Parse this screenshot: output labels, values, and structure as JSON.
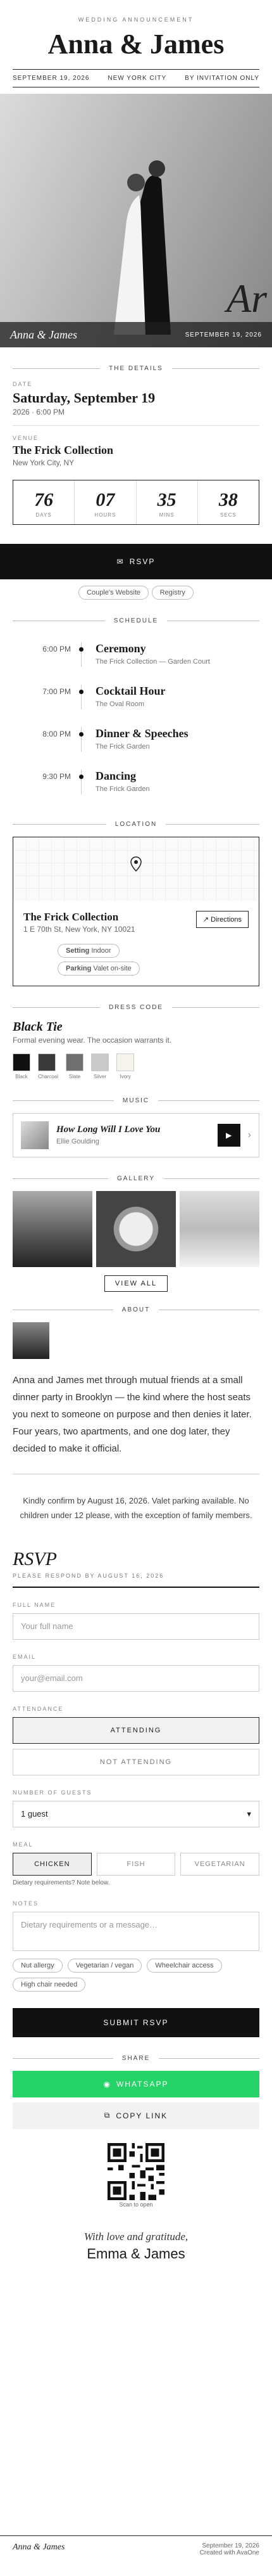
{
  "header": {
    "kicker": "WEDDING ANNOUNCEMENT",
    "names": "Anna & James",
    "date": "SEPTEMBER 19, 2026",
    "city": "NEW YORK CITY",
    "access": "BY INVITATION ONLY"
  },
  "hero": {
    "names": "Anna & James",
    "date": "SEPTEMBER 19, 2026",
    "monogram": "Ar"
  },
  "details": {
    "title": "THE DETAILS",
    "date_label": "DATE",
    "date_value": "Saturday, September 19",
    "time": "2026 · 6:00 PM",
    "venue_label": "VENUE",
    "venue": "The Frick Collection",
    "venue_city": "New York City, NY"
  },
  "countdown": [
    {
      "n": "76",
      "u": "DAYS"
    },
    {
      "n": "07",
      "u": "HOURS"
    },
    {
      "n": "35",
      "u": "MINS"
    },
    {
      "n": "38",
      "u": "SECS"
    }
  ],
  "rsvp_bar": "RSVP",
  "links": [
    "Couple's Website",
    "Registry"
  ],
  "schedule": {
    "title": "SCHEDULE",
    "items": [
      {
        "t": "6:00 PM",
        "e": "Ceremony",
        "p": "The Frick Collection — Garden Court"
      },
      {
        "t": "7:00 PM",
        "e": "Cocktail Hour",
        "p": "The Oval Room"
      },
      {
        "t": "8:00 PM",
        "e": "Dinner & Speeches",
        "p": "The Frick Garden"
      },
      {
        "t": "9:30 PM",
        "e": "Dancing",
        "p": "The Frick Garden"
      }
    ]
  },
  "location": {
    "title": "LOCATION",
    "venue": "The Frick Collection",
    "address": "1 E 70th St, New York, NY 10021",
    "directions": "Directions",
    "tag1_k": "Setting",
    "tag1_v": "Indoor",
    "tag2_k": "Parking",
    "tag2_v": "Valet on-site"
  },
  "dress": {
    "title": "DRESS CODE",
    "name": "Black Tie",
    "desc": "Formal evening wear. The occasion warrants it.",
    "swatches": [
      {
        "n": "Black",
        "c": "#111111"
      },
      {
        "n": "Charcoal",
        "c": "#3a3a3a"
      },
      {
        "n": "Slate",
        "c": "#707070"
      },
      {
        "n": "Silver",
        "c": "#c9c9c9"
      },
      {
        "n": "Ivory",
        "c": "#f6f3ec"
      }
    ]
  },
  "music": {
    "title": "MUSIC",
    "song": "How Long Will I Love You",
    "artist": "Ellie Goulding"
  },
  "gallery": {
    "title": "GALLERY",
    "view_all": "VIEW ALL"
  },
  "about": {
    "title": "ABOUT",
    "text": "Anna and James met through mutual friends at a small dinner party in Brooklyn — the kind where the host seats you next to someone on purpose and then denies it later. Four years, two apartments, and one dog later, they decided to make it official."
  },
  "note": "Kindly confirm by August 16, 2026. Valet parking available. No children under 12 please, with the exception of family members.",
  "rsvp": {
    "title": "RSVP",
    "deadline": "PLEASE RESPOND BY AUGUST 16, 2026",
    "name_label": "FULL NAME",
    "name_ph": "Your full name",
    "email_label": "EMAIL",
    "email_ph": "your@email.com",
    "att_label": "ATTENDANCE",
    "attending": "ATTENDING",
    "not_attending": "NOT ATTENDING",
    "guests_label": "NUMBER OF GUESTS",
    "guests_value": "1 guest",
    "meal_label": "MEAL",
    "meals": [
      "CHICKEN",
      "FISH",
      "VEGETARIAN"
    ],
    "meal_note": "Dietary requirements? Note below.",
    "notes_label": "NOTES",
    "notes_ph": "Dietary requirements or a message…",
    "tags": [
      "Nut allergy",
      "Vegetarian / vegan",
      "Wheelchair access",
      "High chair needed"
    ],
    "submit": "SUBMIT RSVP"
  },
  "share": {
    "title": "SHARE",
    "whatsapp": "WHATSAPP",
    "copy": "COPY LINK",
    "scan": "Scan to open"
  },
  "footer": {
    "love": "With love and gratitude,",
    "names": "Emma & James",
    "brand": "Anna & James",
    "date": "September 19, 2026",
    "credit": "Created with AvaOne"
  }
}
